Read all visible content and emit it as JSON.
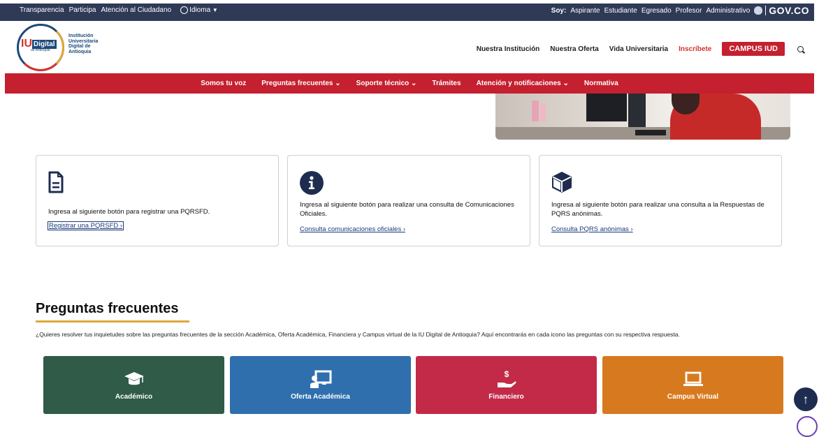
{
  "govbar": {
    "left_links": [
      "Transparencia",
      "Participa",
      "Atención al Ciudadano"
    ],
    "language_label": "Idioma",
    "soy_label": "Soy:",
    "roles": [
      "Aspirante",
      "Estudiante",
      "Egresado",
      "Profesor",
      "Administrativo"
    ],
    "gov_logo": "GOV.CO"
  },
  "header": {
    "logo_iu": "IU",
    "logo_digital": "Digital",
    "logo_sub": "de Antioquia",
    "institution_name": [
      "Institución",
      "Universitaria",
      "Digital de",
      "Antioquia"
    ],
    "nav": [
      "Nuestra Institución",
      "Nuestra Oferta",
      "Vida Universitaria"
    ],
    "inscribete": "Inscríbete",
    "campus_button": "CAMPUS IUD"
  },
  "subnav": {
    "items": [
      "Somos tu voz",
      "Preguntas frecuentes",
      "Soporte técnico",
      "Trámites",
      "Atención y notificaciones",
      "Normativa"
    ]
  },
  "cards": [
    {
      "icon": "document-icon",
      "text": "Ingresa al siguiente botón para registrar una PQRSFD.",
      "link": "Registrar una PQRSFD ›"
    },
    {
      "icon": "info-icon",
      "text": "Ingresa al siguiente botón para realizar una consulta de Comunicaciones Oficiales.",
      "link": "Consulta comunicaciones oficiales ›"
    },
    {
      "icon": "cube-icon",
      "text": "Ingresa al siguiente botón para realizar una consulta a la Respuestas de PQRS anónimas.",
      "link": "Consulta PQRS anónimas ›"
    }
  ],
  "faq": {
    "title": "Preguntas frecuentes",
    "intro": "¿Quieres resolver tus inquietudes sobre las preguntas frecuentes de la sección Académica, Oferta Académica, Financiera y Campus virtual de la IU Digital de Antioquia? Aquí encontrarás en cada icono las preguntas con su respectiva respuesta.",
    "tiles": [
      {
        "label": "Académico",
        "icon": "graduation-cap-icon",
        "color": "#2f5b48"
      },
      {
        "label": "Oferta Académica",
        "icon": "teacher-board-icon",
        "color": "#2f6fae"
      },
      {
        "label": "Financiero",
        "icon": "money-hand-icon",
        "color": "#c22a48"
      },
      {
        "label": "Campus Virtual",
        "icon": "laptop-icon",
        "color": "#d77a1f"
      }
    ]
  },
  "colors": {
    "gov_bar": "#2f3a57",
    "brand_red": "#c4202f",
    "brand_blue": "#1c4a7a",
    "accent_gold": "#e0a83a"
  }
}
